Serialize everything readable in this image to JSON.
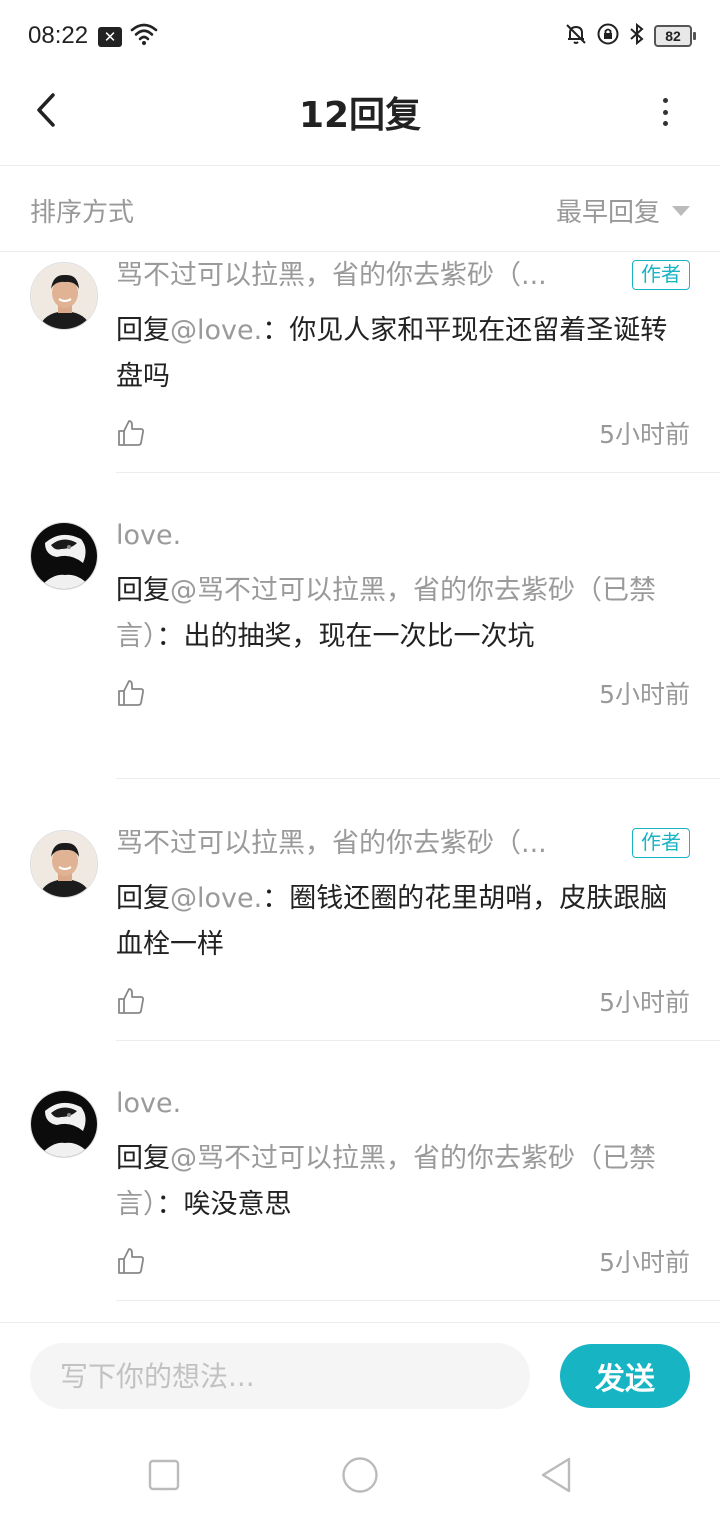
{
  "status_bar": {
    "time": "08:22",
    "notification_icon": "close-box-icon",
    "battery": "82"
  },
  "header": {
    "title": "12回复",
    "back_icon": "chevron-left-icon",
    "more_icon": "more-vertical-icon"
  },
  "sort": {
    "label": "排序方式",
    "value": "最早回复"
  },
  "replies": [
    {
      "name": "骂不过可以拉黑，省的你去紫砂（...",
      "badge": "作者",
      "prefix": "回复",
      "at": "@love.",
      "text": "：你见人家和平现在还留着圣诞转盘吗",
      "time": "5小时前",
      "avatar": "avatar-boy"
    },
    {
      "name": "love.",
      "badge": "",
      "prefix": "回复",
      "at": "@骂不过可以拉黑，省的你去紫砂（已禁言）",
      "text": "：出的抽奖，现在一次比一次坑",
      "time": "5小时前",
      "avatar": "avatar-dark"
    },
    {
      "name": "骂不过可以拉黑，省的你去紫砂（...",
      "badge": "作者",
      "prefix": "回复",
      "at": "@love.",
      "text": "：圈钱还圈的花里胡哨，皮肤跟脑血栓一样",
      "time": "5小时前",
      "avatar": "avatar-boy"
    },
    {
      "name": "love.",
      "badge": "",
      "prefix": "回复",
      "at": "@骂不过可以拉黑，省的你去紫砂（已禁言）",
      "text": "：唉没意思",
      "time": "5小时前",
      "avatar": "avatar-dark"
    }
  ],
  "input": {
    "placeholder": "写下你的想法...",
    "value": "",
    "send_label": "发送"
  },
  "colors": {
    "accent": "#17b4c4",
    "muted_text": "#999999",
    "divider": "#ececec"
  }
}
